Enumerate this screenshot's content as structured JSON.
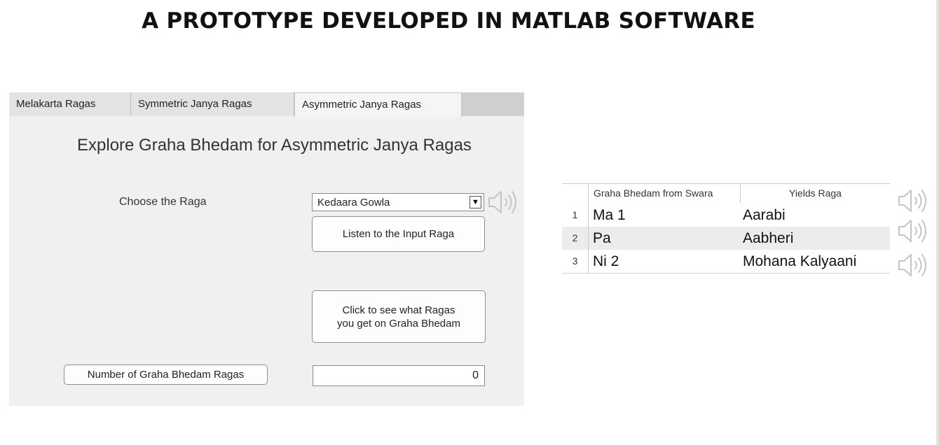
{
  "page_title": "A PROTOTYPE DEVELOPED IN MATLAB SOFTWARE",
  "tabs": [
    {
      "label": "Melakarta Ragas",
      "active": false
    },
    {
      "label": "Symmetric Janya Ragas",
      "active": false
    },
    {
      "label": "Asymmetric Janya Ragas",
      "active": true
    }
  ],
  "heading": "Explore Graha Bhedam for Asymmetric Janya Ragas",
  "choose_label": "Choose the Raga",
  "raga_select": {
    "selected": "Kedaara Gowla",
    "arrow_icon": "triangle-down"
  },
  "listen_button": "Listen to the Input Raga",
  "see_button_lines": [
    "Click to see what Ragas",
    "you get on Graha Bhedam"
  ],
  "count_button": "Number of Graha Bhedam Ragas",
  "count_value": "0",
  "results_table": {
    "columns": [
      "",
      "Graha Bhedam from Swara",
      "Yields Raga"
    ],
    "rows": [
      {
        "index": "1",
        "swara": "Ma 1",
        "raga": "Aarabi"
      },
      {
        "index": "2",
        "swara": "Pa",
        "raga": "Aabheri"
      },
      {
        "index": "3",
        "swara": "Ni 2",
        "raga": "Mohana Kalyaani"
      }
    ]
  },
  "icons": {
    "play": "speaker-icon"
  },
  "colors": {
    "panel_bg": "#f0f0f0",
    "tabbar_bg": "#cfcfcf",
    "row_stripe": "#ececec",
    "speaker_gray": "#c4c4c4"
  }
}
